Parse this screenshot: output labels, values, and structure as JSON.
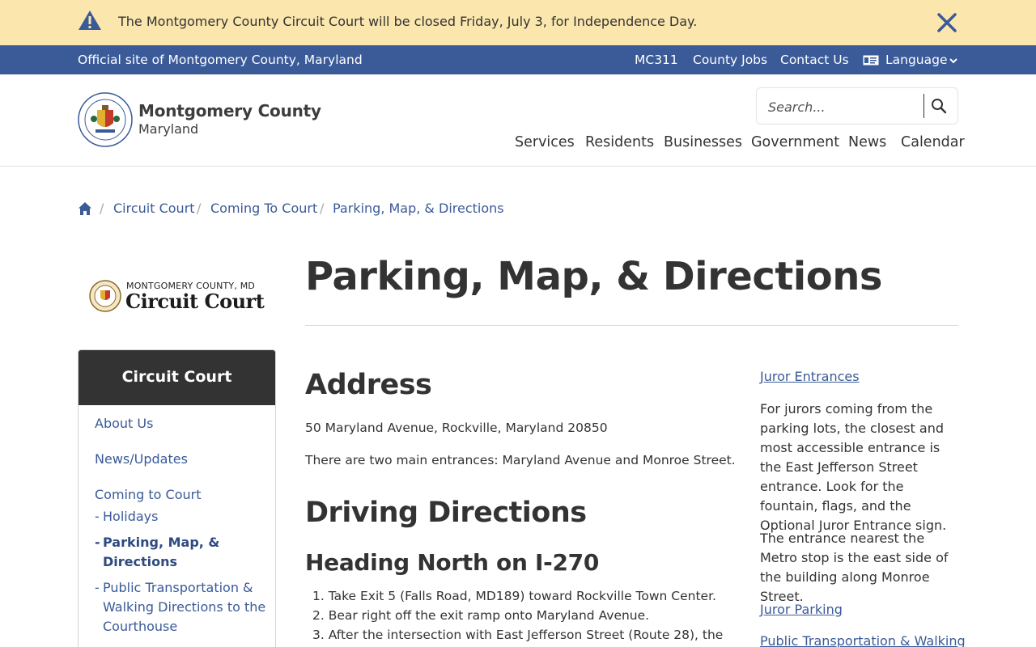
{
  "alert": {
    "text": "The Montgomery County Circuit Court will be closed Friday, July 3, for Independence Day."
  },
  "utility": {
    "official": "Official site of Montgomery County, Maryland",
    "links": [
      "MC311",
      "County Jobs",
      "Contact Us"
    ],
    "language": "Language"
  },
  "header": {
    "brand_name": "Montgomery County",
    "brand_sub": "Maryland",
    "search_placeholder": "Search...",
    "nav": [
      "Services",
      "Residents",
      "Businesses",
      "Government",
      "News",
      "Calendar"
    ]
  },
  "breadcrumb": [
    "Circuit Court",
    "Coming To Court",
    "Parking, Map, & Directions"
  ],
  "court_logo": {
    "top": "MONTGOMERY COUNTY, MD",
    "main": "Circuit Court"
  },
  "sidebar": {
    "heading": "Circuit Court",
    "items": [
      "About Us",
      "News/Updates",
      "Coming to Court"
    ],
    "subitems": [
      {
        "label": "Holidays",
        "active": false
      },
      {
        "label": "Parking, Map, & Directions",
        "active": true
      },
      {
        "label": "Public Transportation & Walking Directions to the Courthouse",
        "active": false
      }
    ]
  },
  "main": {
    "title": "Parking, Map, & Directions",
    "address_heading": "Address",
    "address": "50 Maryland Avenue, Rockville, Maryland 20850",
    "entrances": "There are two main entrances: Maryland Avenue and Monroe Street.",
    "driving_heading": "Driving Directions",
    "north_heading": "Heading North on I-270",
    "steps": [
      "1. Take Exit 5 (Falls Road, MD189) toward Rockville Town Center.",
      "2. Bear right off the exit ramp onto Maryland Avenue.",
      "3. After the intersection with East Jefferson Street (Route 28), the"
    ]
  },
  "right": {
    "juror_entrances": "Juror Entrances",
    "juror_entrances_text": "For jurors coming from the parking lots, the closest and most accessible entrance is the East Jefferson Street entrance. Look for the fountain, flags, and the Optional Juror Entrance sign.",
    "metro_text": "The entrance nearest the Metro stop is the east side of the building along Monroe Street.",
    "juror_parking": "Juror Parking",
    "public_transport": "Public Transportation & Walking"
  },
  "colors": {
    "alert_bg": "#fbe7ad",
    "utility_bg": "#3a5a98",
    "link": "#3a5a98",
    "sidebar_head": "#333333"
  }
}
